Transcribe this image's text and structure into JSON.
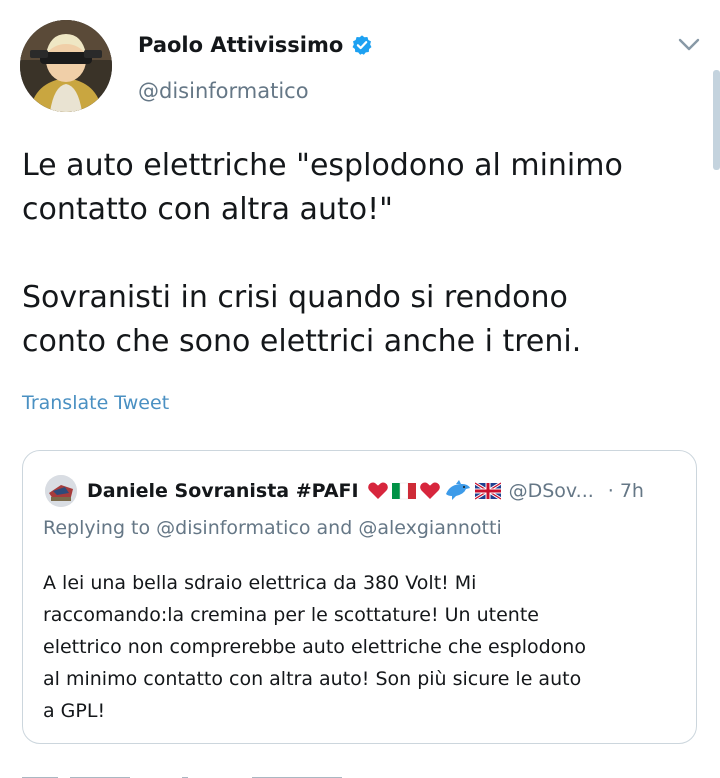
{
  "author": {
    "name": "Paolo Attivissimo",
    "handle": "@disinformatico",
    "verified": true
  },
  "tweet": {
    "lines": [
      "Le auto elettriche \"esplodono al minimo",
      "contatto con altra auto!\"",
      "Sovranisti in crisi quando si rendono",
      "conto che sono elettrici anche i treni."
    ],
    "translate_label": "Translate Tweet"
  },
  "quoted": {
    "name": "Daniele Sovranista #PAFI",
    "emoji": [
      "red-heart",
      "italy-flag",
      "red-heart",
      "dolphin",
      "uk-flag"
    ],
    "handle": "@DSov...",
    "separator": "·",
    "time": "7h",
    "replying_prefix": "Replying to",
    "replying_mention_1": "@disinformatico",
    "replying_and": "and",
    "replying_mention_2": "@alexgiannotti",
    "text_lines": [
      "A lei una bella sdraio elettrica da 380 Volt! Mi",
      "raccomando:la cremina per le scottature! Un utente",
      "elettrico non comprerebbe auto elettriche che esplodono",
      "al minimo contatto con altra auto! Son più sicure le auto",
      "a GPL!"
    ]
  },
  "colors": {
    "verified": "#1da1f2",
    "link": "#4a90c2",
    "secondary_text": "#657786",
    "border": "#ccd6dd"
  }
}
